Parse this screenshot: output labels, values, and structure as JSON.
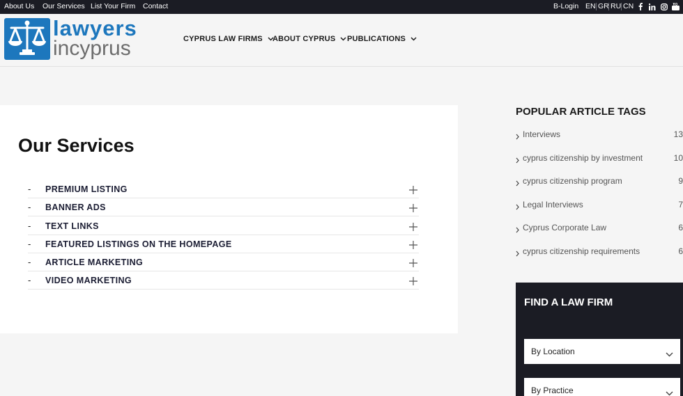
{
  "topbar": {
    "links": [
      "About Us",
      "Our Services",
      "List Your Firm",
      "Contact"
    ],
    "login": "B-Login",
    "languages": [
      "EN",
      "GR",
      "RU",
      "CN"
    ],
    "social_icons": [
      "facebook-icon",
      "linkedin-icon",
      "instagram-icon",
      "youtube-icon"
    ]
  },
  "logo": {
    "line1": "lawyers",
    "line2": "incyprus",
    "icon": "scales-of-justice-icon",
    "color": "#1d77bd"
  },
  "nav": [
    "CYPRUS LAW FIRMS",
    "ABOUT CYPRUS",
    "PUBLICATIONS"
  ],
  "main": {
    "title": "Our Services",
    "items": [
      {
        "dash": "-",
        "label": "PREMIUM LISTING"
      },
      {
        "dash": "-",
        "label": "BANNER ADS"
      },
      {
        "dash": "-",
        "label": "TEXT LINKS"
      },
      {
        "dash": "-",
        "label": "FEATURED LISTINGS ON THE HOMEPAGE"
      },
      {
        "dash": "-",
        "label": "ARTICLE MARKETING"
      },
      {
        "dash": "-",
        "label": "VIDEO MARKETING"
      }
    ]
  },
  "sidebar": {
    "tags_title": "POPULAR ARTICLE TAGS",
    "tags": [
      {
        "name": "Interviews",
        "count": "13"
      },
      {
        "name": "cyprus citizenship by investment",
        "count": "10"
      },
      {
        "name": "cyprus citizenship program",
        "count": "9"
      },
      {
        "name": "Legal Interviews",
        "count": "7"
      },
      {
        "name": "Cyprus Corporate Law",
        "count": "6"
      },
      {
        "name": "cyprus citizenship requirements",
        "count": "6"
      }
    ],
    "finder": {
      "title": "FIND A LAW FIRM",
      "selects": [
        "By Location",
        "By Practice"
      ]
    }
  },
  "colors": {
    "topbar_bg": "#1b1c24",
    "brand_blue": "#1d77bd",
    "page_bg": "#f5f5f5"
  }
}
